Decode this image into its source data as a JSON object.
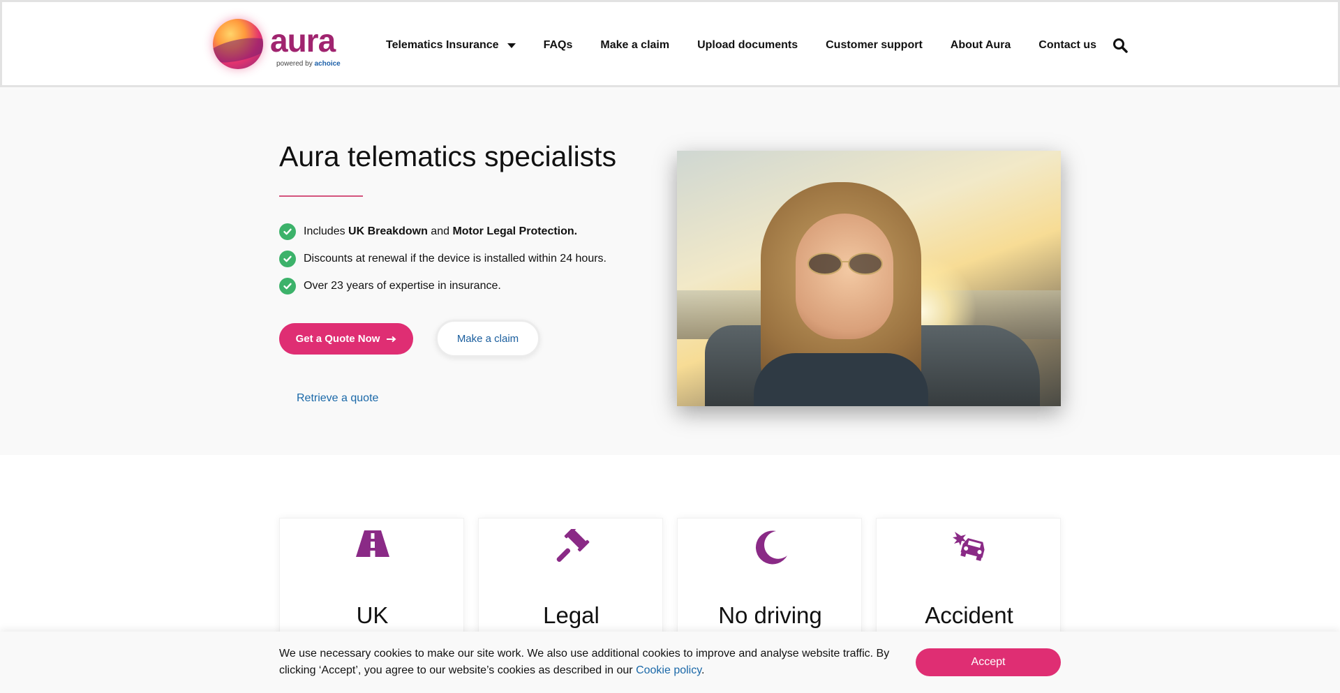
{
  "brand": {
    "name": "aura",
    "powered_prefix": "powered by",
    "powered_brand": "achoice"
  },
  "nav": {
    "items": [
      {
        "label": "Telematics Insurance",
        "has_dropdown": true
      },
      {
        "label": "FAQs"
      },
      {
        "label": "Make a claim"
      },
      {
        "label": "Upload documents"
      },
      {
        "label": "Customer support"
      },
      {
        "label": "About Aura"
      },
      {
        "label": "Contact us"
      }
    ],
    "search_icon": "search-icon"
  },
  "hero": {
    "title": "Aura telematics specialists",
    "bullets": {
      "b1_pre": "Includes ",
      "b1_strong1": "UK Breakdown",
      "b1_mid": " and ",
      "b1_strong2": "Motor Legal Protection.",
      "b2": "Discounts at renewal if the device is installed within 24 hours.",
      "b3": "Over 23 years of expertise in insurance."
    },
    "cta_quote": "Get a Quote Now",
    "cta_quote_icon": "arrow-right-icon",
    "cta_claim": "Make a claim",
    "retrieve_link": "Retrieve a quote"
  },
  "features": [
    {
      "title": "UK",
      "icon": "road-icon"
    },
    {
      "title": "Legal",
      "icon": "gavel-icon"
    },
    {
      "title": "No driving",
      "icon": "moon-icon"
    },
    {
      "title": "Accident",
      "icon": "car-crash-icon"
    }
  ],
  "cookie": {
    "text": "We use necessary cookies to make our site work. We also use additional cookies to improve and analyse website traffic. By clicking ‘Accept’, you agree to our website’s cookies as described in our ",
    "link": "Cookie policy",
    "end": ".",
    "accept": "Accept"
  },
  "colors": {
    "accent": "#df2e73",
    "brand_purple": "#8a2a86",
    "check_green": "#3cb26a",
    "link_blue": "#1a68a8"
  }
}
